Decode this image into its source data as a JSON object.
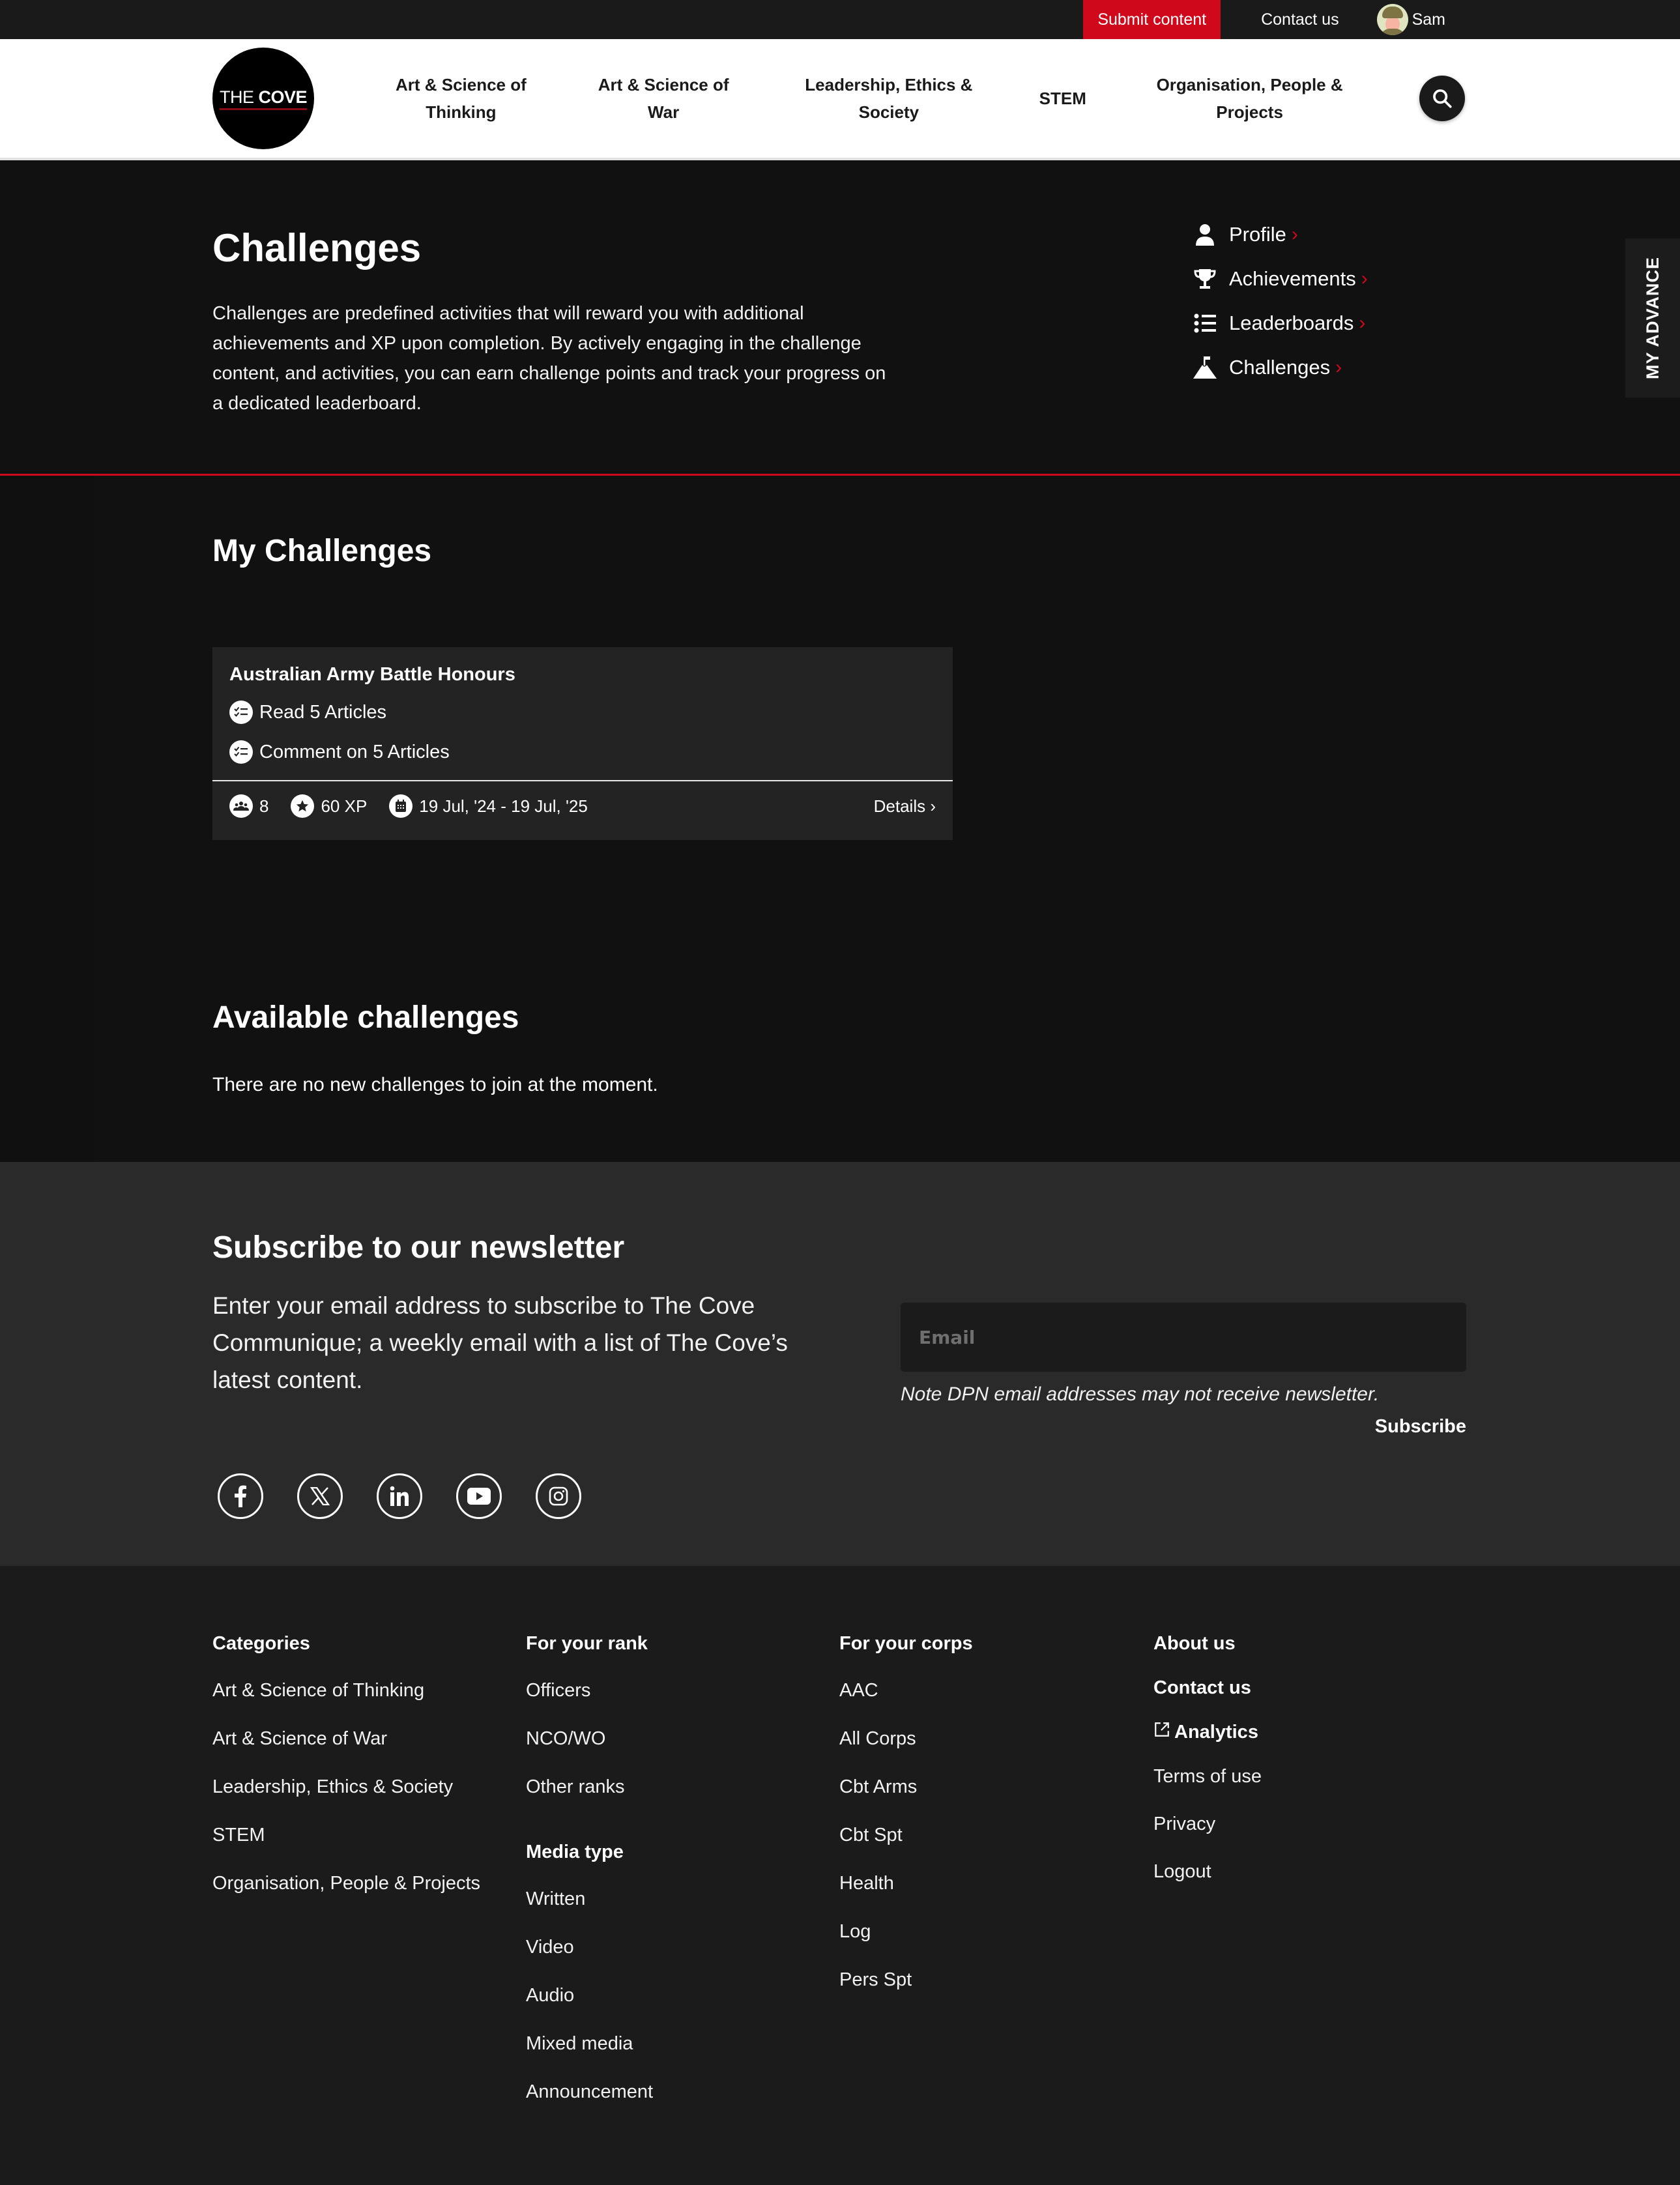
{
  "utility_bar": {
    "submit_label": "Submit content",
    "contact_label": "Contact us",
    "user_name": "Sam"
  },
  "header": {
    "logo_the": "THE",
    "logo_cove": "COVE",
    "nav": [
      {
        "label": "Art & Science of Thinking"
      },
      {
        "label": "Art & Science of War"
      },
      {
        "label": "Leadership, Ethics & Society"
      },
      {
        "label": "STEM"
      },
      {
        "label": "Organisation, People & Projects"
      }
    ]
  },
  "hero": {
    "title": "Challenges",
    "description": "Challenges are predefined activities that will reward you with additional achievements and XP upon completion. By actively engaging in the challenge content, and activities, you can earn challenge points and track your progress on a dedicated leaderboard.",
    "quick_links": [
      {
        "label": "Profile",
        "icon": "user-icon"
      },
      {
        "label": "Achievements",
        "icon": "trophy-icon"
      },
      {
        "label": "Leaderboards",
        "icon": "list-icon"
      },
      {
        "label": "Challenges",
        "icon": "mountain-flag-icon"
      }
    ],
    "my_advance_label": "MY ADVANCE"
  },
  "my_challenges": {
    "heading": "My Challenges",
    "cards": [
      {
        "title": "Australian Army Battle Honours",
        "tasks": [
          "Read 5 Articles",
          "Comment on 5 Articles"
        ],
        "participants": "8",
        "xp": "60 XP",
        "date_range": "19 Jul, '24 - 19 Jul, '25",
        "details_label": "Details ›"
      }
    ]
  },
  "available_challenges": {
    "heading": "Available challenges",
    "empty_message": "There are no new challenges to join at the moment."
  },
  "newsletter": {
    "heading": "Subscribe to our newsletter",
    "description": "Enter your email address to subscribe to The Cove Communique; a weekly email with a list of The Cove’s latest content.",
    "email_placeholder": "Email",
    "email_value": "",
    "note": "Note DPN email addresses may not receive newsletter.",
    "subscribe_label": "Subscribe",
    "socials": [
      "facebook",
      "x",
      "linkedin",
      "youtube",
      "instagram"
    ]
  },
  "footer": {
    "categories": {
      "heading": "Categories",
      "links": [
        "Art & Science of Thinking",
        "Art & Science of War",
        "Leadership, Ethics & Society",
        "STEM",
        "Organisation, People & Projects"
      ]
    },
    "rank": {
      "heading": "For your rank",
      "links": [
        "Officers",
        "NCO/WO",
        "Other ranks"
      ]
    },
    "media": {
      "heading": "Media type",
      "links": [
        "Written",
        "Video",
        "Audio",
        "Mixed media",
        "Announcement"
      ]
    },
    "corps": {
      "heading": "For your corps",
      "links": [
        "AAC",
        "All Corps",
        "Cbt Arms",
        "Cbt Spt",
        "Health",
        "Log",
        "Pers Spt"
      ]
    },
    "about": {
      "bold_links": [
        "About us",
        "Contact us",
        "Analytics"
      ],
      "links": [
        "Terms of use",
        "Privacy",
        "Logout"
      ]
    }
  },
  "colors": {
    "accent_red": "#d0081c",
    "page_bg": "#111111",
    "card_bg": "#232323",
    "newsletter_bg": "#2a2a2a",
    "footer_bg": "#1b1b1b"
  }
}
